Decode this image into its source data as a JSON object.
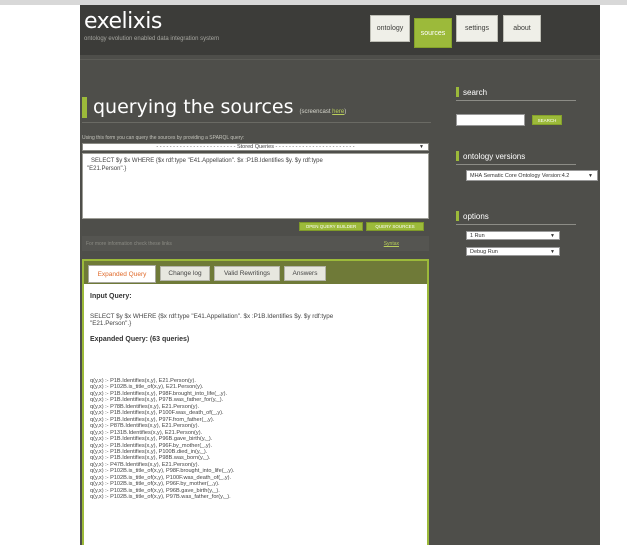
{
  "app": {
    "logo": "exelixis",
    "tagline": "ontology evolution enabled data integration system"
  },
  "nav": {
    "items": [
      {
        "label": "ontology"
      },
      {
        "label": "sources"
      },
      {
        "label": "settings"
      },
      {
        "label": "about"
      }
    ],
    "active": "sources"
  },
  "main": {
    "title": "querying the sources",
    "screencast_prefix": "(screencast ",
    "screencast_link": "here",
    "screencast_suffix": ")",
    "intro": "Using this form you can query the sources by providing a SPARQL query:",
    "stored_queries": "- - - - - - - - - - - - - - - - - - - - - - - - Stored Queries - - - - - - - - - - - - - - - - - - - - - - - -",
    "query_line1": "SELECT $y $x WHERE {$x rdf:type \"E41.Appellation\". $x :P1B.Identifies $y. $y rdf:type",
    "query_line2": "\"E21.Person\".}",
    "open_query_builder": "OPEN QUERY BUILDER",
    "query_sources": "QUERY SOURCES",
    "more_info": "For more information check these links",
    "syntax_link": "Syntax"
  },
  "tabs": [
    {
      "label": "Expanded Query"
    },
    {
      "label": "Change log"
    },
    {
      "label": "Valid Rewritings"
    },
    {
      "label": "Answers"
    }
  ],
  "panel": {
    "input_heading": "Input Query:",
    "input_line1": "SELECT $y $x WHERE {$x rdf:type \"E41.Appellation\". $x :P1B.Identifies $y. $y rdf:type",
    "input_line2": "\"E21.Person\".}",
    "expanded_heading": "Expanded Query: (63 queries)",
    "lines": [
      "q(y,x) :- P1B.Identifies(x,y), E21.Person(y).",
      "q(y,x) :- P102B.is_title_of(x,y), E21.Person(y).",
      "q(y,x) :- P1B.Identifies(x,y), P98F.brought_into_life(_,y).",
      "q(y,x) :- P1B.Identifies(x,y), P97B.was_father_for(y,_).",
      "q(y,x) :- P78B.Identifies(x,y), E21.Person(y).",
      "q(y,x) :- P1B.Identifies(x,y), P100F.was_death_of(_,y).",
      "q(y,x) :- P1B.Identifies(x,y), P97F.from_father(_,y).",
      "q(y,x) :- P87B.Identifies(x,y), E21.Person(y).",
      "q(y,x) :- P131B.Identifies(x,y), E21.Person(y).",
      "q(y,x) :- P1B.Identifies(x,y), P96B.gave_birth(y,_).",
      "q(y,x) :- P1B.Identifies(x,y), P96F.by_mother(_,y).",
      "q(y,x) :- P1B.Identifies(x,y), P100B.died_in(y,_).",
      "q(y,x) :- P1B.Identifies(x,y), P98B.was_born(y,_).",
      "q(y,x) :- P47B.Identifies(x,y), E21.Person(y).",
      "q(y,x) :- P102B.is_title_of(x,y), P98F.brought_into_life(_,y).",
      "q(y,x) :- P102B.is_title_of(x,y), P100F.was_death_of(_,y).",
      "q(y,x) :- P102B.is_title_of(x,y), P96F.by_mother(_,y).",
      "q(y,x) :- P102B.is_title_of(x,y), P96B.gave_birth(y,_).",
      "q(y,x) :- P102B.is_title_of(x,y), P97B.was_father_for(y,_)."
    ]
  },
  "sidebar": {
    "search_title": "search",
    "search_button": "SEARCH",
    "versions_title": "ontology versions",
    "version_selected": "MHA Sematic Core Ontology Version:4.2",
    "options_title": "options",
    "option1": "1 Run",
    "option2": "Debug Run"
  },
  "colors": {
    "accent": "#9cba3a",
    "background": "#4e4e4a",
    "active_tab_text": "#e06a2a"
  }
}
